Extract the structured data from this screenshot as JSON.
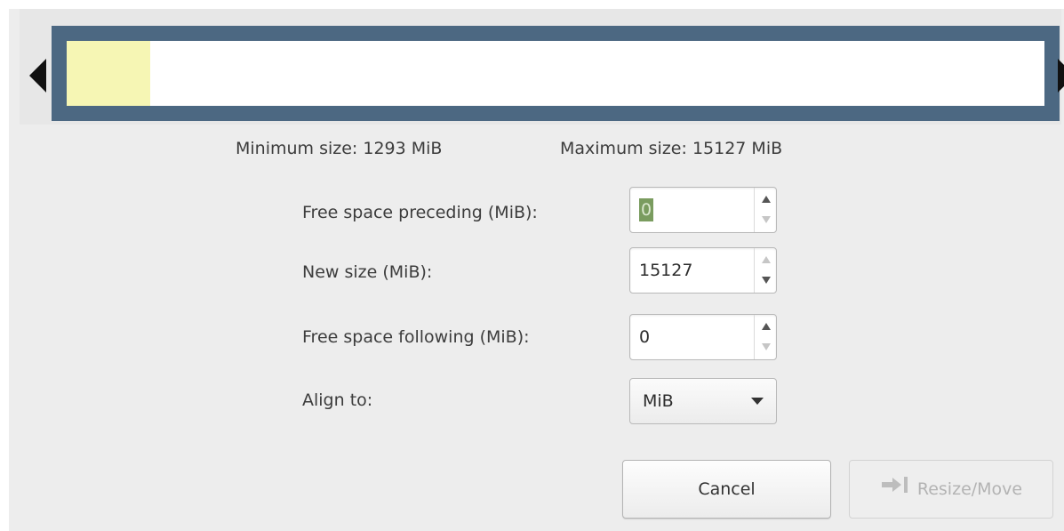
{
  "partition_bar": {
    "used_fraction": 0.085,
    "used_color": "#f6f6b4",
    "frame_color": "#4c6882"
  },
  "limits": {
    "minimum": "Minimum size: 1293 MiB",
    "maximum": "Maximum size: 15127 MiB"
  },
  "fields": {
    "free_preceding": {
      "label": "Free space preceding (MiB):",
      "value": "0"
    },
    "new_size": {
      "label": "New size (MiB):",
      "value": "15127"
    },
    "free_following": {
      "label": "Free space following (MiB):",
      "value": "0"
    },
    "align_to": {
      "label": "Align to:",
      "value": "MiB"
    }
  },
  "buttons": {
    "cancel": "Cancel",
    "resize_move": "Resize/Move"
  },
  "icons": {
    "left_handle": "triangle-left-icon",
    "right_handle": "triangle-right-icon",
    "resize": "arrow-to-bar-icon"
  }
}
